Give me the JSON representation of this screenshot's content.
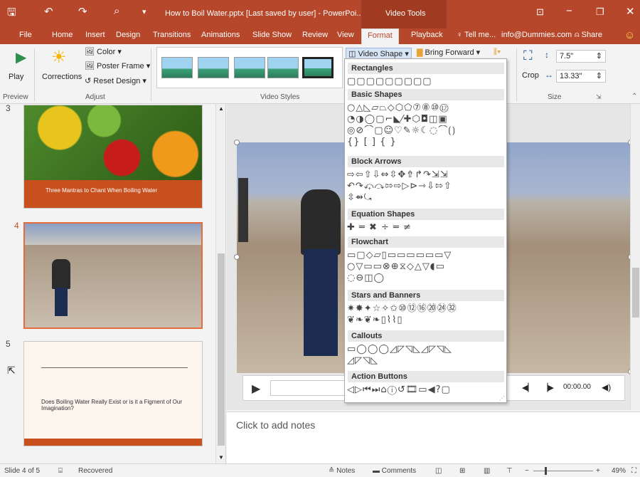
{
  "window": {
    "title": "How to Boil Water.pptx [Last saved by user] - PowerPoi...",
    "context_tab_group": "Video Tools",
    "account": "info@Dummies.com",
    "share_label": "Share",
    "tell_me": "Tell me..."
  },
  "tabs": [
    "File",
    "Home",
    "Insert",
    "Design",
    "Transitions",
    "Animations",
    "Slide Show",
    "Review",
    "View",
    "Format",
    "Playback"
  ],
  "active_tab": "Format",
  "ribbon": {
    "preview": {
      "play_label": "Play",
      "group_label": "Preview"
    },
    "adjust": {
      "corrections_label": "Corrections",
      "color_label": "Color",
      "poster_frame_label": "Poster Frame",
      "reset_design_label": "Reset Design",
      "group_label": "Adjust"
    },
    "video_styles": {
      "group_label": "Video Styles",
      "video_shape_label": "Video Shape"
    },
    "arrange": {
      "bring_forward_label": "Bring Forward"
    },
    "size": {
      "crop_label": "Crop",
      "height_value": "7.5\"",
      "width_value": "13.33\"",
      "group_label": "Size"
    }
  },
  "dropdown": {
    "sections": [
      {
        "title": "Rectangles",
        "glyphs": [
          "▢▢▢▢▢▢▢▢▢"
        ]
      },
      {
        "title": "Basic Shapes",
        "glyphs": [
          "○△◺▱⏢◇⬡⬠⑦⑧⑩⑫",
          "◔◑◯▢⌐◣⁄✚⬡◘◫▣",
          "◎⊘⌒▢☺♡✎☼☾◌⌒⟮⟯",
          "{} [ ] { }"
        ]
      },
      {
        "title": "Block Arrows",
        "glyphs": [
          "⇨⇦⇧⇩⇔⇳✥⇮↱↷⇲⇲",
          "↶↷⤽⤼⇰⇨▷⊳⇾⇩⇰⇧",
          "⇳⇴⤿"
        ]
      },
      {
        "title": "Equation Shapes",
        "glyphs": [
          "✚ ═ ✖ ÷ ═ ≠"
        ]
      },
      {
        "title": "Flowchart",
        "glyphs": [
          "▭▢◇▱▯▭▭▭▭▭▭▽",
          "○▽▭▭⊗⊕⧖◇△▽◖▭",
          "◌⊖◫◯"
        ]
      },
      {
        "title": "Stars and Banners",
        "glyphs": [
          "✷✸✦☆✧✩⑩⑫⑯⑳㉔㉜",
          "❦❧❦❧▯⌇⌇▯"
        ]
      },
      {
        "title": "Callouts",
        "glyphs": [
          "▭◯◯◯◿◸◹◺◿◸◹◺",
          "◿◸◹◺"
        ]
      },
      {
        "title": "Action Buttons",
        "glyphs": [
          "◁▷⏮⏭⌂ⓘ↺🎞▭◀?▢"
        ]
      }
    ]
  },
  "slides": [
    {
      "number": "3",
      "caption": "Three Mantras to Chant When Boiling Water"
    },
    {
      "number": "4"
    },
    {
      "number": "5",
      "caption": "Does Boiling Water Really Exist or is it a Figment of Our Imagination?"
    }
  ],
  "player": {
    "time": "00:00.00"
  },
  "notes": {
    "placeholder": "Click to add notes"
  },
  "status": {
    "slide_info": "Slide 4 of 5",
    "recovered": "Recovered",
    "notes_label": "Notes",
    "comments_label": "Comments",
    "zoom": "49%"
  },
  "colors": {
    "accent": "#b7472a",
    "slide_orange": "#c8501f"
  }
}
